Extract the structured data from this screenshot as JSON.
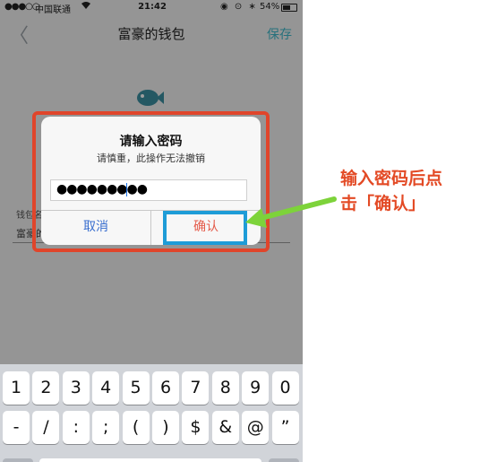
{
  "status_bar": {
    "signal": "●●●○○",
    "carrier": "中国联通",
    "wifi_icon": "wifi-icon",
    "time": "21:42",
    "right_icons": "◉ ⊙ ∗",
    "battery_pct": "54%",
    "battery_level": 0.54
  },
  "nav": {
    "back_glyph": "〈",
    "title": "富豪的钱包",
    "save_label": "保存"
  },
  "form": {
    "wallet_label": "钱包名",
    "wallet_value": "富豪的"
  },
  "dialog": {
    "title": "请输入密码",
    "message": "请慎重，此操作无法撤销",
    "password_mask": "●●●●●●●●●",
    "cancel_label": "取消",
    "confirm_label": "确认"
  },
  "annotation": {
    "line1": "输入密码后点",
    "line2": "击「确认」",
    "text_color": "#e34a25",
    "frame_color": "#e0452b",
    "highlight_color": "#1e9cd7",
    "arrow_color": "#7dd33a"
  },
  "keyboard": {
    "row1": [
      "1",
      "2",
      "3",
      "4",
      "5",
      "6",
      "7",
      "8",
      "9",
      "0"
    ],
    "row2": [
      "-",
      "/",
      ":",
      ";",
      "(",
      ")",
      "$",
      "&",
      "@",
      "”"
    ]
  }
}
